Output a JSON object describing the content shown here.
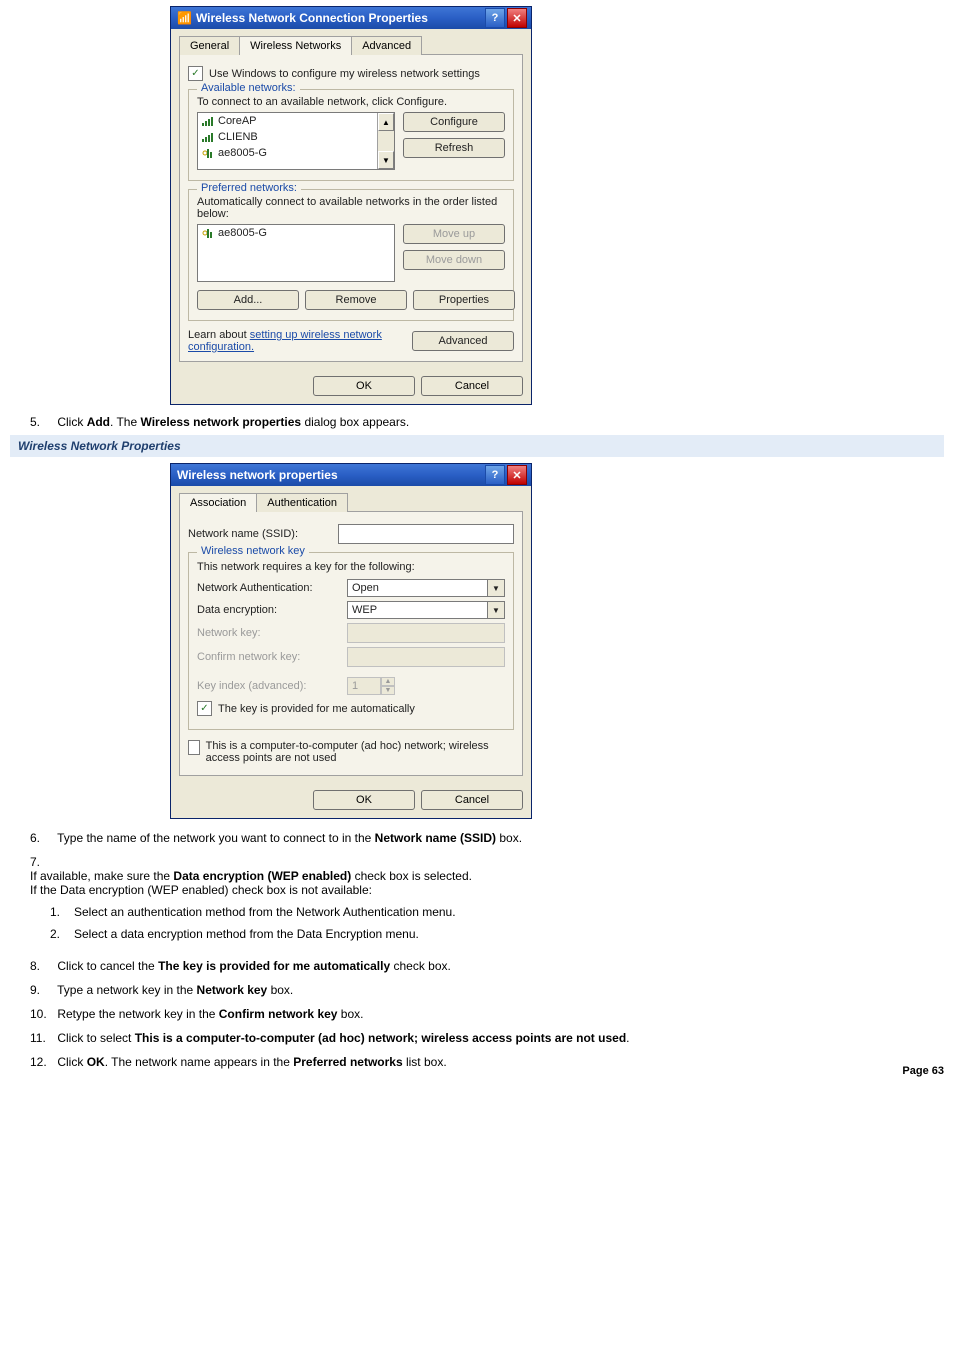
{
  "dlg1": {
    "title": "Wireless Network Connection Properties",
    "tabs": [
      "General",
      "Wireless Networks",
      "Advanced"
    ],
    "use_windows_label": "Use Windows to configure my wireless network settings",
    "avail_legend": "Available networks:",
    "avail_hint": "To connect to an available network, click Configure.",
    "avail_items": [
      "CoreAP",
      "CLIENB",
      "ae8005-G"
    ],
    "btn_configure": "Configure",
    "btn_refresh": "Refresh",
    "pref_legend": "Preferred networks:",
    "pref_hint": "Automatically connect to available networks in the order listed below:",
    "pref_items": [
      "ae8005-G"
    ],
    "btn_moveup": "Move up",
    "btn_movedown": "Move down",
    "btn_add": "Add...",
    "btn_remove": "Remove",
    "btn_props": "Properties",
    "learn_pre": "Learn about ",
    "learn_link": "setting up wireless network configuration.",
    "btn_advanced": "Advanced",
    "btn_ok": "OK",
    "btn_cancel": "Cancel"
  },
  "step5": {
    "num": "5.",
    "pre": "Click ",
    "b1": "Add",
    "mid": ". The ",
    "b2": "Wireless network properties",
    "post": " dialog box appears."
  },
  "band1": "Wireless Network Properties",
  "dlg2": {
    "title": "Wireless network properties",
    "tabs": [
      "Association",
      "Authentication"
    ],
    "ssid_label": "Network name (SSID):",
    "key_legend": "Wireless network key",
    "key_hint": "This network requires a key for the following:",
    "auth_label": "Network Authentication:",
    "auth_value": "Open",
    "enc_label": "Data encryption:",
    "enc_value": "WEP",
    "nkey_label": "Network key:",
    "cnkey_label": "Confirm network key:",
    "kidx_label": "Key index (advanced):",
    "kidx_value": "1",
    "autokey_label": "The key is provided for me automatically",
    "adhoc_label": "This is a computer-to-computer (ad hoc) network; wireless access points are not used",
    "btn_ok": "OK",
    "btn_cancel": "Cancel"
  },
  "step6": {
    "num": "6.",
    "pre": "Type the name of the network you want to connect to in the ",
    "b1": "Network name (SSID)",
    "post": " box."
  },
  "step7": {
    "num": "7.",
    "pre": "If available, make sure the ",
    "b1": "Data encryption (WEP enabled)",
    "mid": " check box is selected.",
    "line2": "If the Data encryption (WEP enabled) check box is not available:",
    "sub1": {
      "num": "1.",
      "text": "Select an authentication method from the Network Authentication menu."
    },
    "sub2": {
      "num": "2.",
      "text": "Select a data encryption method from the Data Encryption menu."
    }
  },
  "step8": {
    "num": "8.",
    "pre": "Click to cancel the ",
    "b1": "The key is provided for me automatically",
    "post": " check box."
  },
  "step9": {
    "num": "9.",
    "pre": "Type a network key in the ",
    "b1": "Network key",
    "post": " box."
  },
  "step10": {
    "num": "10.",
    "pre": "Retype the network key in the ",
    "b1": "Confirm network key",
    "post": " box."
  },
  "step11": {
    "num": "11.",
    "pre": "Click to select ",
    "b1": "This is a computer-to-computer (ad hoc) network; wireless access points are not used",
    "post": "."
  },
  "step12": {
    "num": "12.",
    "pre": "Click ",
    "b1": "OK",
    "mid": ". The network name appears in the ",
    "b2": "Preferred networks",
    "post": " list box."
  },
  "pagenum": "Page 63"
}
